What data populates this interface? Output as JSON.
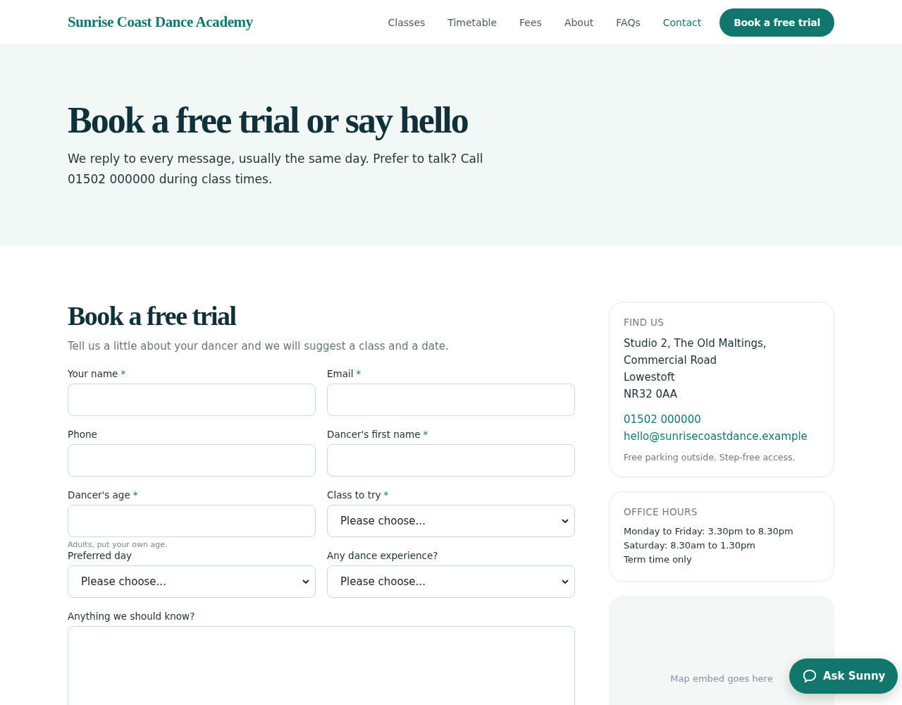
{
  "header": {
    "logo": "Sunrise Coast Dance Academy",
    "nav": [
      {
        "label": "Classes",
        "selected": false
      },
      {
        "label": "Timetable",
        "selected": false
      },
      {
        "label": "Fees",
        "selected": false
      },
      {
        "label": "About",
        "selected": false
      },
      {
        "label": "FAQs",
        "selected": false
      },
      {
        "label": "Contact",
        "selected": true
      }
    ],
    "cta": "Book a free trial"
  },
  "hero": {
    "title": "Book a free trial or say hello",
    "text": "We reply to every message, usually the same day. Prefer to talk? Call 01502 000000 during class times."
  },
  "form": {
    "title": "Book a free trial",
    "intro": "Tell us a little about your dancer and we will suggest a class and a date.",
    "fields": [
      {
        "kind": "input",
        "label": "Your name",
        "required": "*"
      },
      {
        "kind": "input",
        "label": "Email",
        "required": "*"
      },
      {
        "kind": "input",
        "label": "Phone"
      },
      {
        "kind": "input",
        "label": "Dancer's first name",
        "required": "*"
      },
      {
        "kind": "input",
        "label": "Dancer's age",
        "required": "*",
        "hint": "Adults, put your own age."
      },
      {
        "kind": "select",
        "label": "Class to try",
        "required": "*",
        "value": "Please choose..."
      },
      {
        "kind": "select",
        "label": "Preferred day",
        "value": "Please choose..."
      },
      {
        "kind": "select",
        "label": "Any dance experience?",
        "value": "Please choose..."
      },
      {
        "kind": "textarea",
        "label": "Anything we should know?"
      }
    ]
  },
  "find_us": {
    "heading": "FIND US",
    "address": [
      "Studio 2, The Old Maltings,",
      "Commercial Road",
      "Lowestoft",
      "NR32 0AA"
    ],
    "phone": "01502 000000",
    "email": "hello@sunrisecoastdance.example",
    "note": "Free parking outside. Step-free access."
  },
  "office_hours": {
    "heading": "OFFICE HOURS",
    "lines": [
      "Monday to Friday: 3.30pm to 8.30pm",
      "Saturday: 8.30am to 1.30pm",
      "Term time only"
    ]
  },
  "map": {
    "placeholder": "Map embed goes here"
  },
  "chat_button": "Ask Sunny"
}
